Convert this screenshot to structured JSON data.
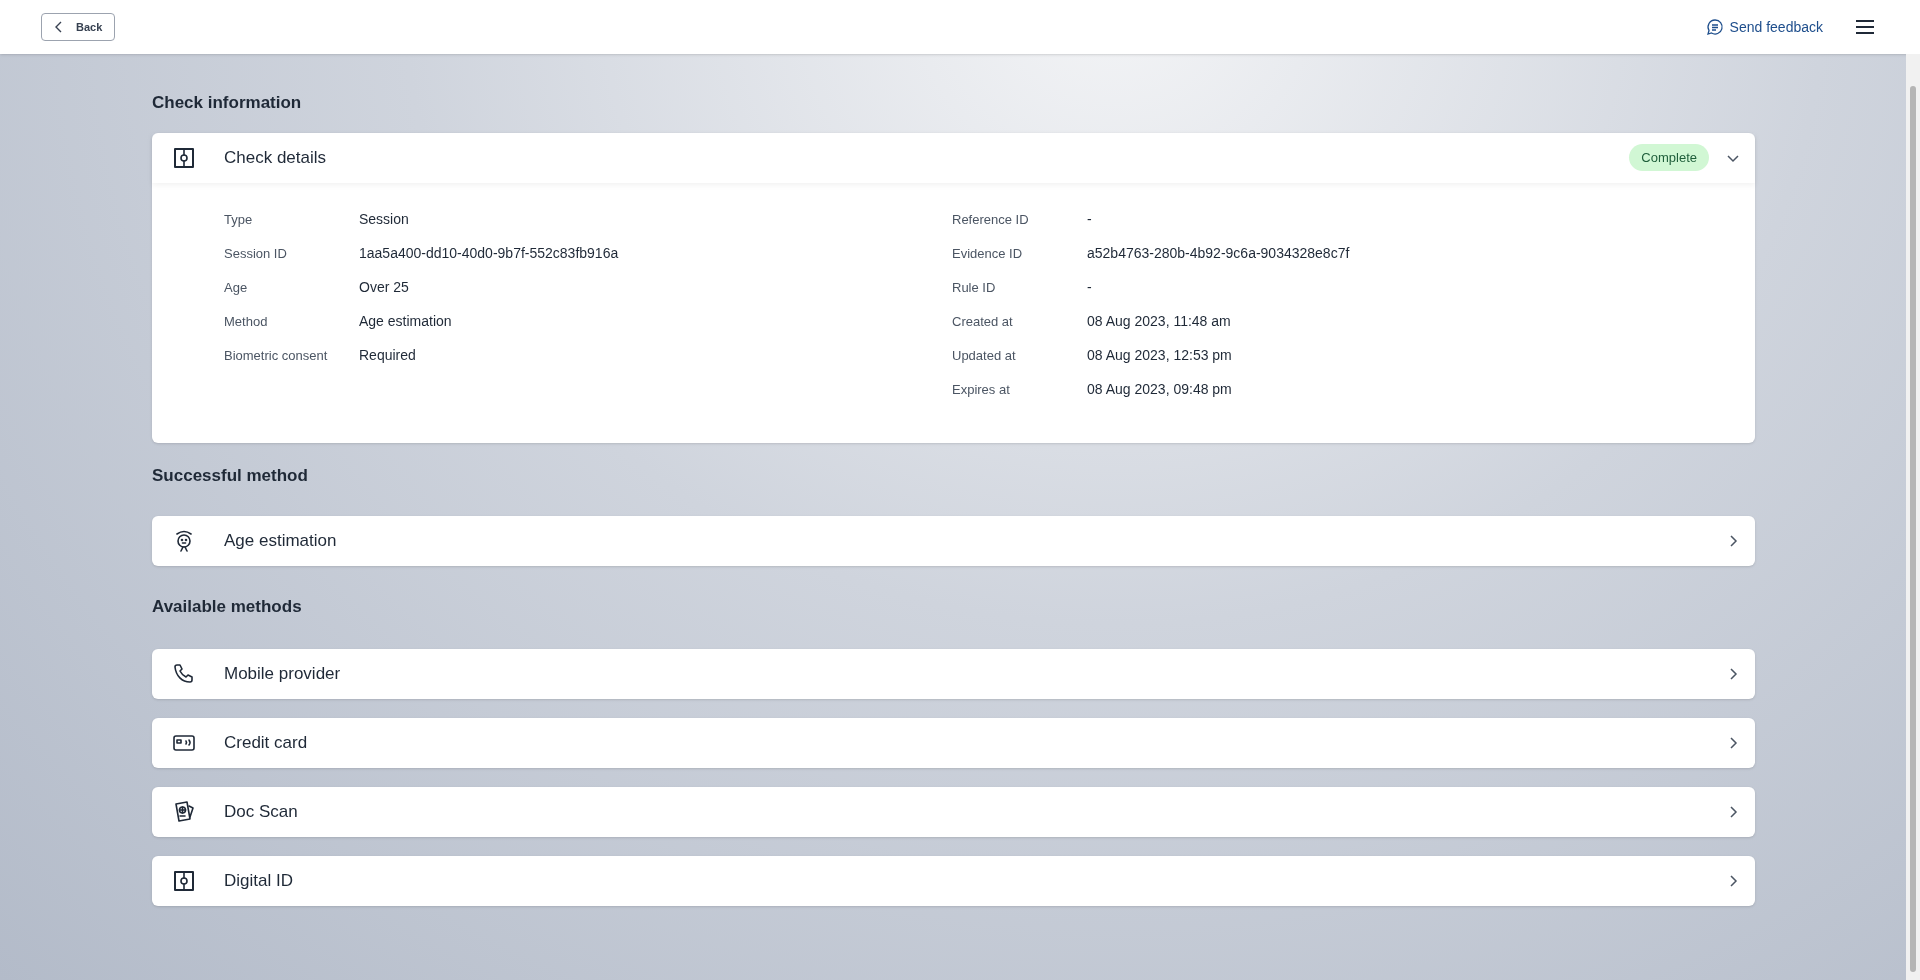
{
  "header": {
    "back_button": "Back",
    "feedback_link": "Send feedback"
  },
  "check_information": {
    "title": "Check information",
    "card": {
      "title": "Check details",
      "kind": "id",
      "status": "Complete",
      "expanded": true,
      "left_fields": [
        {
          "label": "Type",
          "value": "Session"
        },
        {
          "label": "Session ID",
          "value": "1aa5a400-dd10-40d0-9b7f-552c83fb916a"
        },
        {
          "label": "Age",
          "value": "Over 25"
        },
        {
          "label": "Method",
          "value": "Age estimation"
        },
        {
          "label": "Biometric consent",
          "value": "Required"
        }
      ],
      "right_fields": [
        {
          "label": "Reference ID",
          "value": "-"
        },
        {
          "label": "Evidence ID",
          "value": "a52b4763-280b-4b92-9c6a-9034328e8c7f"
        },
        {
          "label": "Rule ID",
          "value": "-"
        },
        {
          "label": "Created at",
          "value": "08 Aug 2023, 11:48 am"
        },
        {
          "label": "Updated at",
          "value": "08 Aug 2023, 12:53 pm"
        },
        {
          "label": "Expires at",
          "value": "08 Aug 2023, 09:48 pm"
        }
      ]
    }
  },
  "successful_method": {
    "title": "Successful method",
    "items": [
      {
        "label": "Age estimation",
        "kind": "face"
      }
    ]
  },
  "available_methods": {
    "title": "Available methods",
    "items": [
      {
        "label": "Mobile provider",
        "kind": "phone"
      },
      {
        "label": "Credit card",
        "kind": "card"
      },
      {
        "label": "Doc Scan",
        "kind": "doc"
      },
      {
        "label": "Digital ID",
        "kind": "id"
      }
    ]
  }
}
